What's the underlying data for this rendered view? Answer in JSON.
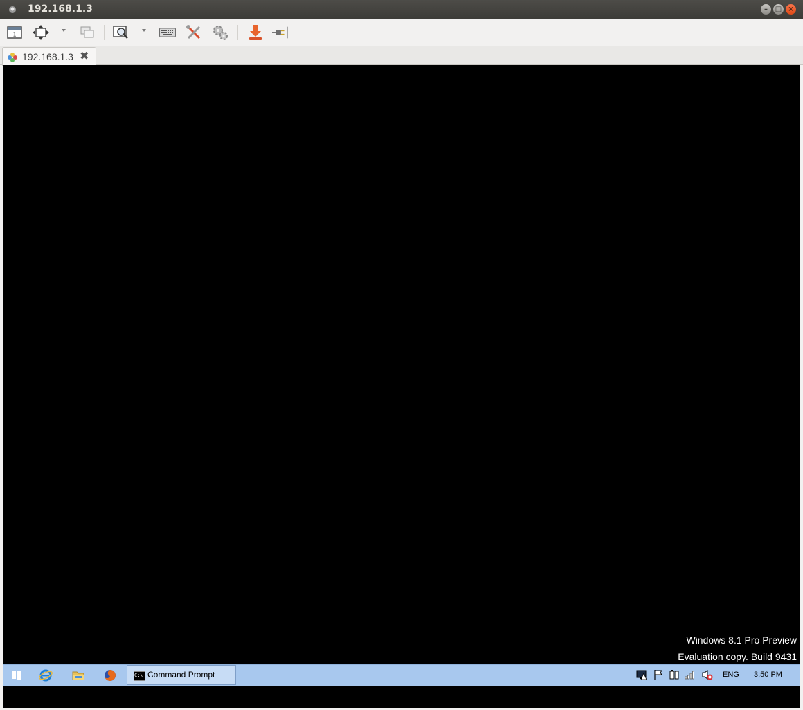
{
  "window": {
    "title": "192.168.1.3"
  },
  "toolbar": {
    "buttons": [
      {
        "icon": "window-mode-icon"
      },
      {
        "icon": "scale-icon"
      },
      {
        "icon": "multi-monitor-icon"
      },
      {
        "icon": "zoom-icon"
      },
      {
        "icon": "keyboard-icon"
      },
      {
        "icon": "tools-icon"
      },
      {
        "icon": "preferences-icon"
      },
      {
        "icon": "download-icon"
      },
      {
        "icon": "disconnect-icon"
      }
    ]
  },
  "tabs": [
    {
      "label": "192.168.1.3",
      "close_glyph": "✖"
    }
  ],
  "remote": {
    "watermark_line1": "Windows 8.1 Pro Preview",
    "watermark_line2": "Evaluation copy. Build 9431",
    "taskbar": {
      "pinned": [
        "start-icon",
        "internet-explorer-icon",
        "file-explorer-icon",
        "firefox-icon"
      ],
      "active_task": {
        "label": "Command Prompt",
        "icon_text": "C:\\"
      },
      "tray": {
        "icons": [
          "action-center-icon",
          "flag-icon",
          "power-icon",
          "network-icon",
          "volume-muted-icon"
        ],
        "language": "ENG",
        "time": "3:50 PM"
      }
    }
  },
  "colors": {
    "titlebar": "#3c3b37",
    "taskbar": "#a8c8ee",
    "close_button": "#df4a16"
  }
}
